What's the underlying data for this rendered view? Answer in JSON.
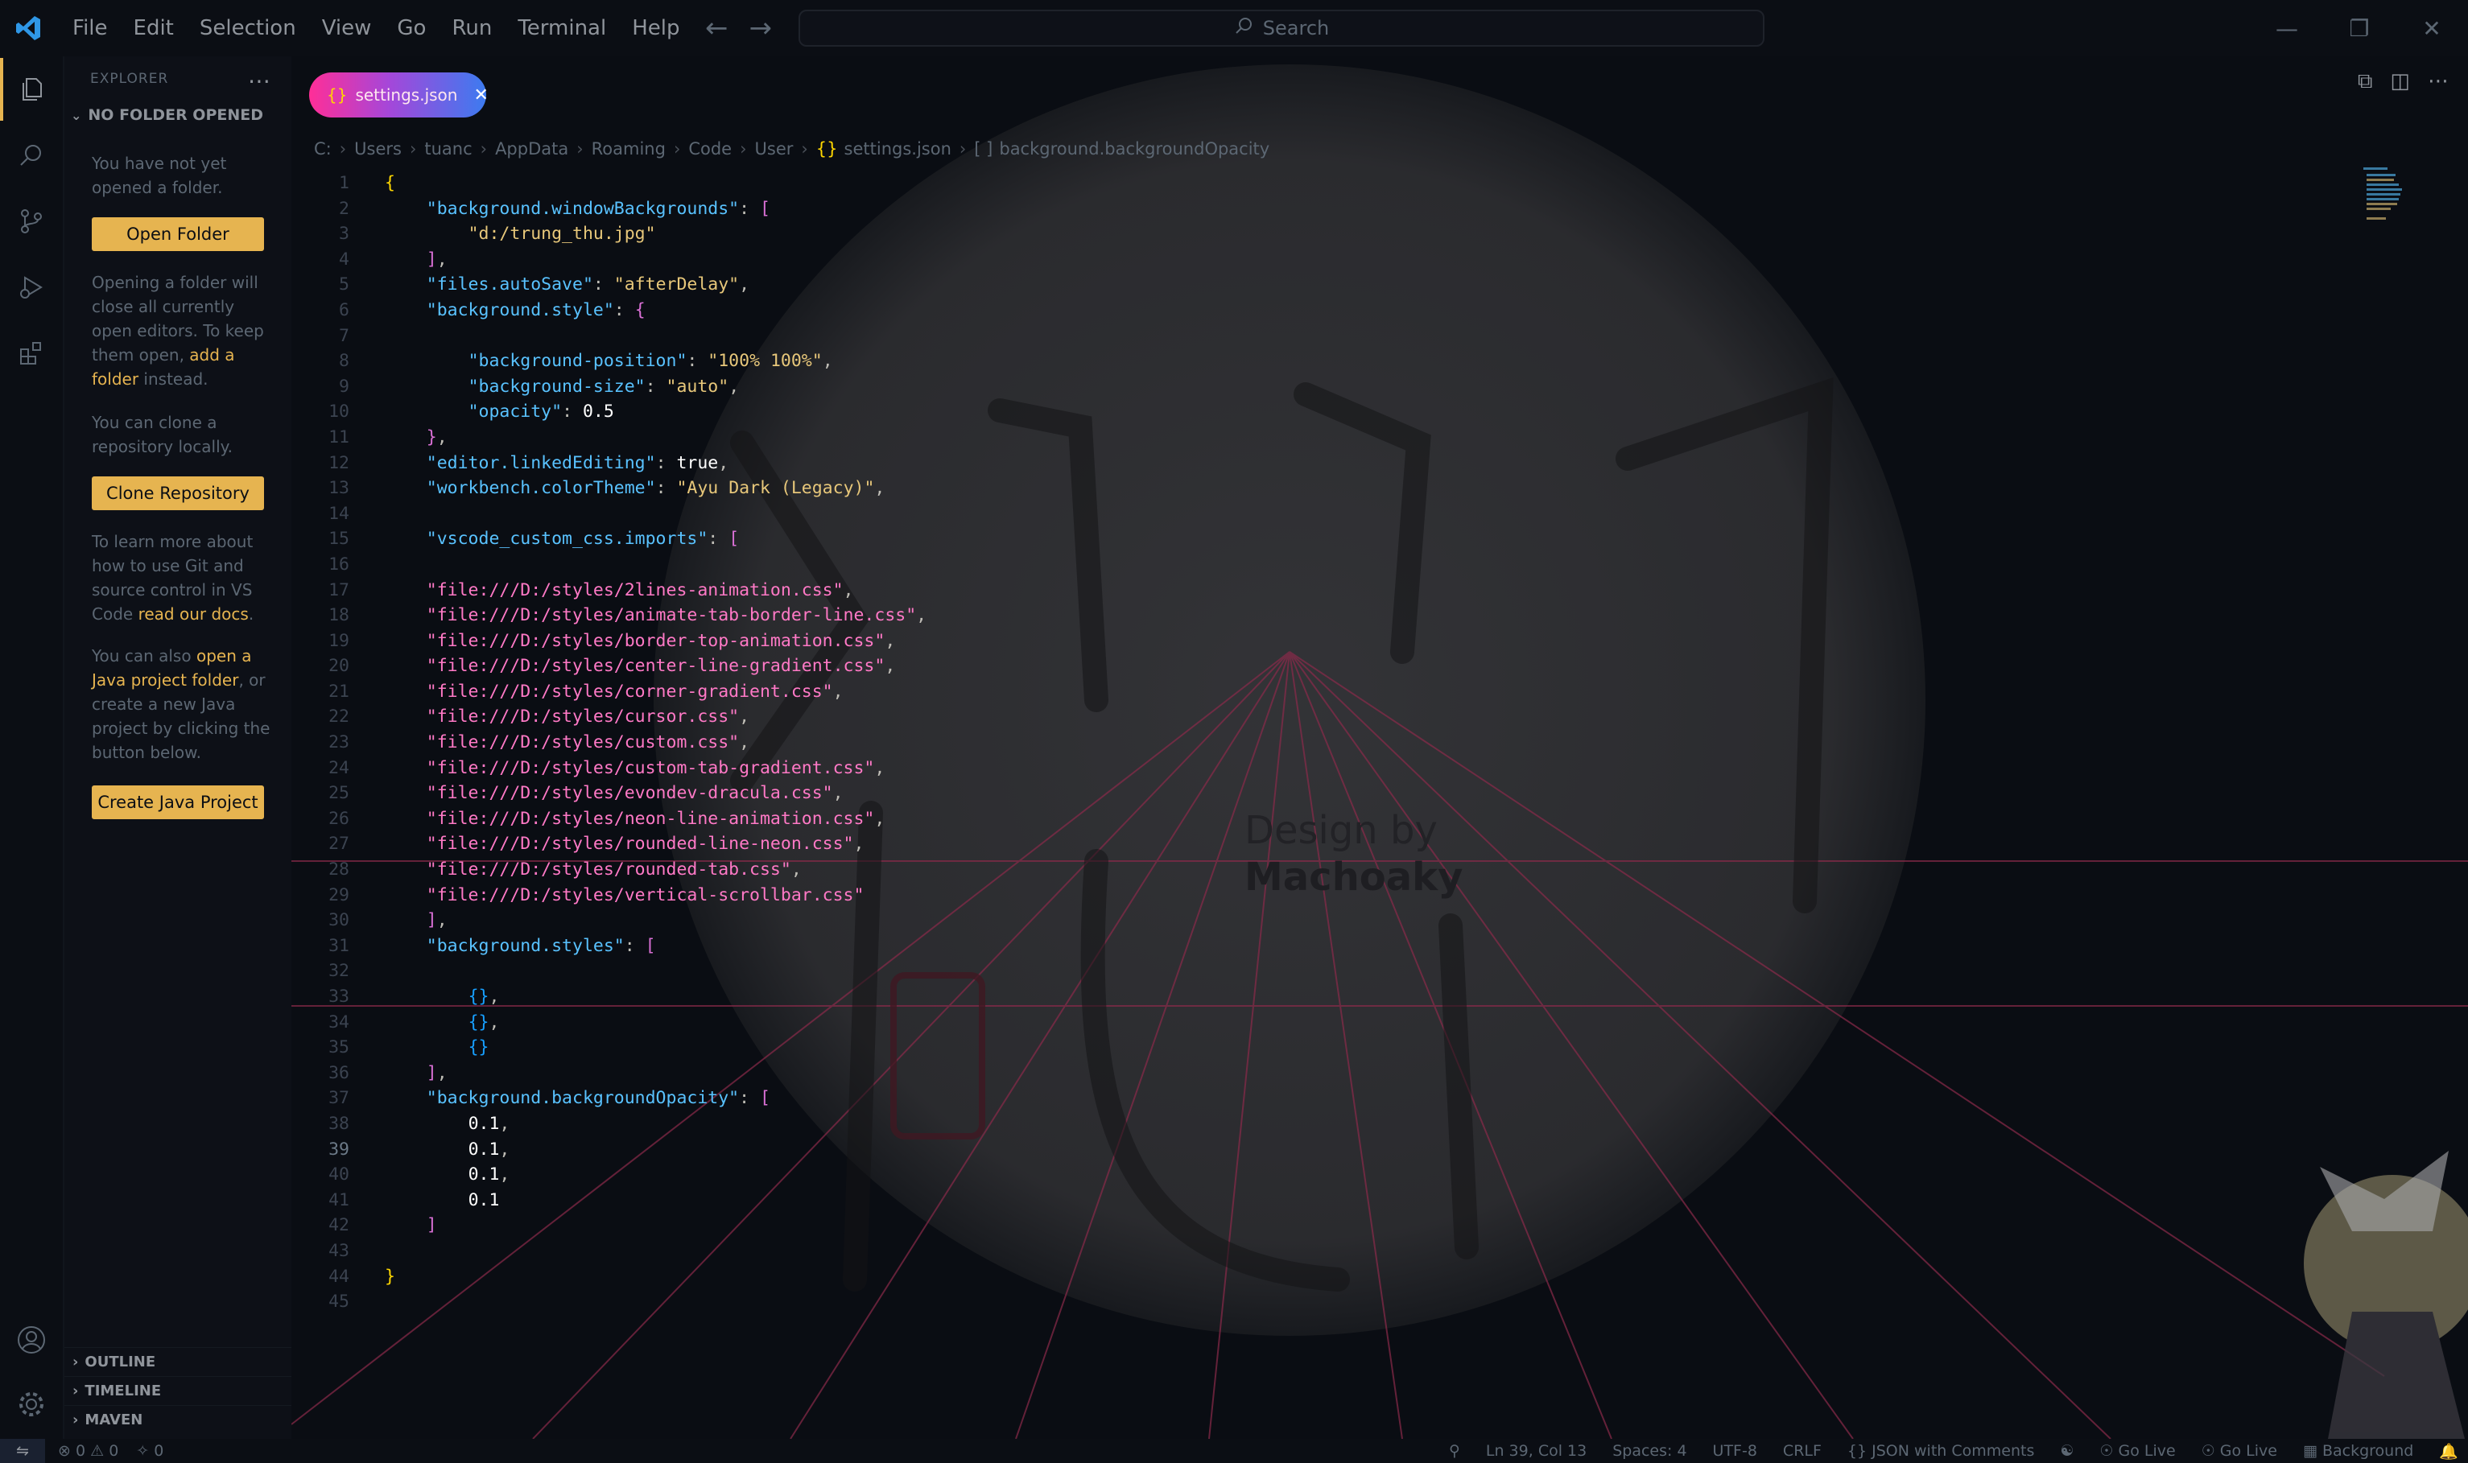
{
  "menu": [
    "File",
    "Edit",
    "Selection",
    "View",
    "Go",
    "Run",
    "Terminal",
    "Help"
  ],
  "search": {
    "placeholder": "Search"
  },
  "sidebar": {
    "header": "EXPLORER",
    "section": "NO FOLDER OPENED",
    "text1": "You have not yet opened a folder.",
    "open_folder": "Open Folder",
    "text2_a": "Opening a folder will close all currently open editors. To keep them open, ",
    "text2_link": "add a folder",
    "text2_b": " instead.",
    "text3": "You can clone a repository locally.",
    "clone_repo": "Clone Repository",
    "text4_a": "To learn more about how to use Git and source control in VS Code ",
    "text4_link": "read our docs",
    "text4_b": ".",
    "text5_a": "You can also ",
    "text5_link": "open a Java project folder",
    "text5_b": ", or create a new Java project by clicking the button below.",
    "create_java": "Create Java Project",
    "outline": "OUTLINE",
    "timeline": "TIMELINE",
    "maven": "MAVEN"
  },
  "tab": {
    "label": "settings.json"
  },
  "breadcrumb": [
    "C:",
    "Users",
    "tuanc",
    "AppData",
    "Roaming",
    "Code",
    "User",
    "settings.json",
    "background.backgroundOpacity"
  ],
  "editor": {
    "current_line": 39,
    "lines": [
      "{",
      "    \"background.windowBackgrounds\": [",
      "        \"d:/trung_thu.jpg\"",
      "    ],",
      "    \"files.autoSave\": \"afterDelay\",",
      "    \"background.style\": {",
      "",
      "        \"background-position\": \"100% 100%\",",
      "        \"background-size\": \"auto\",",
      "        \"opacity\": 0.5",
      "    },",
      "    \"editor.linkedEditing\": true,",
      "    \"workbench.colorTheme\": \"Ayu Dark (Legacy)\",",
      "",
      "    \"vscode_custom_css.imports\": [",
      "",
      "    \"file:///D:/styles/2lines-animation.css\",",
      "    \"file:///D:/styles/animate-tab-border-line.css\",",
      "    \"file:///D:/styles/border-top-animation.css\",",
      "    \"file:///D:/styles/center-line-gradient.css\",",
      "    \"file:///D:/styles/corner-gradient.css\",",
      "    \"file:///D:/styles/cursor.css\",",
      "    \"file:///D:/styles/custom.css\",",
      "    \"file:///D:/styles/custom-tab-gradient.css\",",
      "    \"file:///D:/styles/evondev-dracula.css\",",
      "    \"file:///D:/styles/neon-line-animation.css\",",
      "    \"file:///D:/styles/rounded-line-neon.css\",",
      "    \"file:///D:/styles/rounded-tab.css\",",
      "    \"file:///D:/styles/vertical-scrollbar.css\"",
      "    ],",
      "    \"background.styles\": [",
      "",
      "        {},",
      "        {},",
      "        {}",
      "    ],",
      "    \"background.backgroundOpacity\": [",
      "        0.1,",
      "        0.1,",
      "        0.1,",
      "        0.1",
      "    ]",
      "",
      "}",
      ""
    ]
  },
  "watermark": {
    "line1": "Design by",
    "line2": "Machoaky"
  },
  "status": {
    "errors": "0",
    "warnings": "0",
    "ports": "0",
    "position": "Ln 39, Col 13",
    "spaces": "Spaces: 4",
    "encoding": "UTF-8",
    "eol": "CRLF",
    "language": "JSON with Comments",
    "golive1": "Go Live",
    "golive2": "Go Live",
    "background": "Background"
  },
  "colors": {
    "accent": "#e6b450",
    "key": "#59c2ff",
    "string": "#ff79c6",
    "bg": "#0b0e14"
  }
}
